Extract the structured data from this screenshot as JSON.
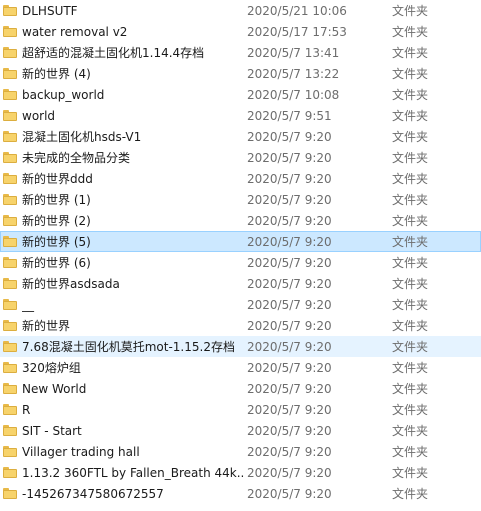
{
  "rows": [
    {
      "name": "DLHSUTF",
      "date": "2020/5/21 10:06",
      "type": "文件夹"
    },
    {
      "name": "water removal v2",
      "date": "2020/5/17 17:53",
      "type": "文件夹"
    },
    {
      "name": "超舒适的混凝土固化机1.14.4存档",
      "date": "2020/5/7 13:41",
      "type": "文件夹"
    },
    {
      "name": "新的世界 (4)",
      "date": "2020/5/7 13:22",
      "type": "文件夹"
    },
    {
      "name": "backup_world",
      "date": "2020/5/7 10:08",
      "type": "文件夹"
    },
    {
      "name": "world",
      "date": "2020/5/7 9:51",
      "type": "文件夹"
    },
    {
      "name": "混凝土固化机hsds-V1",
      "date": "2020/5/7 9:20",
      "type": "文件夹"
    },
    {
      "name": "未完成的全物品分类",
      "date": "2020/5/7 9:20",
      "type": "文件夹"
    },
    {
      "name": "新的世界ddd",
      "date": "2020/5/7 9:20",
      "type": "文件夹"
    },
    {
      "name": "新的世界 (1)",
      "date": "2020/5/7 9:20",
      "type": "文件夹"
    },
    {
      "name": "新的世界 (2)",
      "date": "2020/5/7 9:20",
      "type": "文件夹"
    },
    {
      "name": "新的世界 (5)",
      "date": "2020/5/7 9:20",
      "type": "文件夹"
    },
    {
      "name": "新的世界 (6)",
      "date": "2020/5/7 9:20",
      "type": "文件夹"
    },
    {
      "name": "新的世界asdsada",
      "date": "2020/5/7 9:20",
      "type": "文件夹"
    },
    {
      "name": "__",
      "date": "2020/5/7 9:20",
      "type": "文件夹"
    },
    {
      "name": "新的世界",
      "date": "2020/5/7 9:20",
      "type": "文件夹"
    },
    {
      "name": "7.68混凝土固化机莫托mot-1.15.2存档",
      "date": "2020/5/7 9:20",
      "type": "文件夹"
    },
    {
      "name": "320熔炉组",
      "date": "2020/5/7 9:20",
      "type": "文件夹"
    },
    {
      "name": "New World",
      "date": "2020/5/7 9:20",
      "type": "文件夹"
    },
    {
      "name": "R",
      "date": "2020/5/7 9:20",
      "type": "文件夹"
    },
    {
      "name": "SIT - Start",
      "date": "2020/5/7 9:20",
      "type": "文件夹"
    },
    {
      "name": "Villager trading hall",
      "date": "2020/5/7 9:20",
      "type": "文件夹"
    },
    {
      "name": "1.13.2 360FTL by Fallen_Breath 44k...",
      "date": "2020/5/7 9:20",
      "type": "文件夹"
    },
    {
      "name": "-145267347580672557",
      "date": "2020/5/7 9:20",
      "type": "文件夹"
    }
  ],
  "selected_row": 11,
  "hover_row": 16,
  "colors": {
    "selection_bg": "#cce8ff",
    "selection_border": "#99d1ff",
    "hover_bg": "#e5f3ff",
    "folder_fill": "#f7d36b"
  },
  "icons": {
    "row_icon": "folder-icon"
  }
}
